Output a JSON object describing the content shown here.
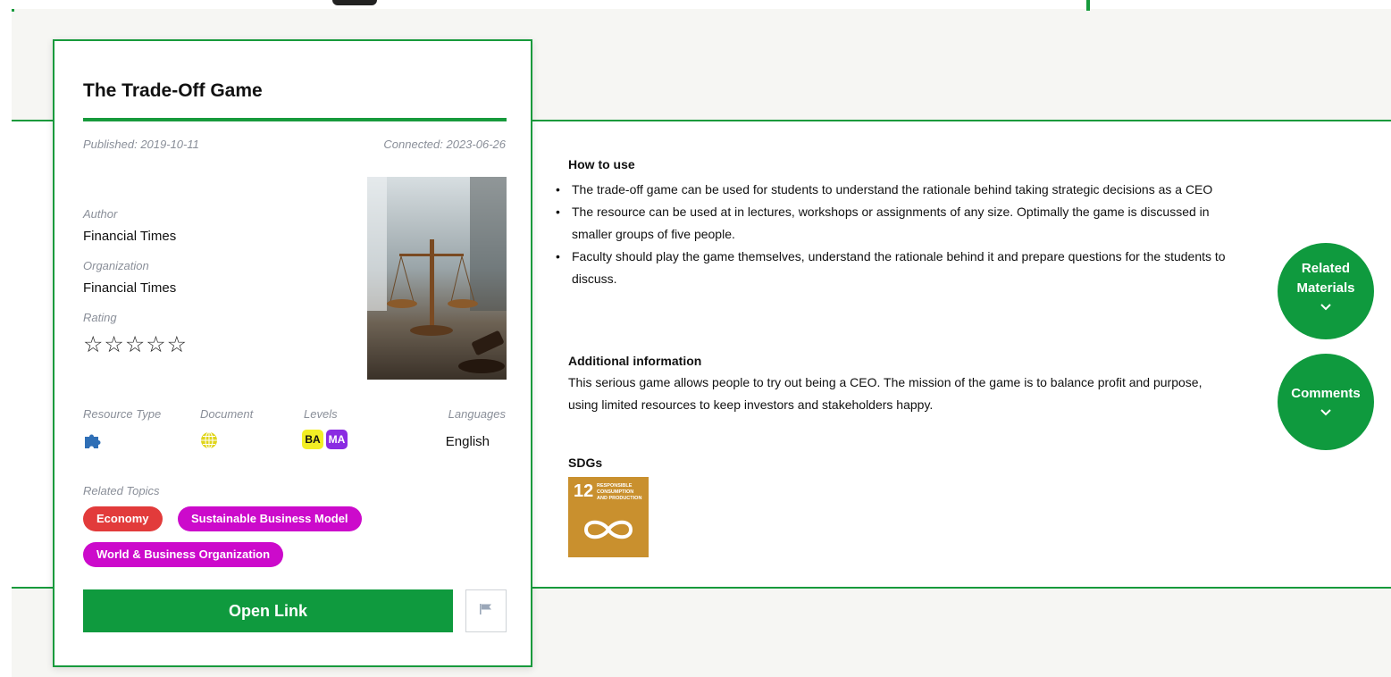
{
  "card": {
    "title": "The Trade-Off Game",
    "published": "Published: 2019-10-11",
    "connected": "Connected: 2023-06-26",
    "author_label": "Author",
    "author": "Financial Times",
    "organization_label": "Organization",
    "organization": "Financial Times",
    "rating_label": "Rating",
    "rating_stars": "☆☆☆☆☆",
    "rating_value": 0,
    "resource_type_label": "Resource Type",
    "resource_type_icon": "puzzle-icon",
    "document_label": "Document",
    "document_icon": "globe-icon",
    "levels_label": "Levels",
    "levels": [
      "BA",
      "MA"
    ],
    "languages_label": "Languages",
    "language": "English",
    "related_topics_label": "Related Topics",
    "topics": [
      {
        "label": "Economy",
        "color": "#e23b3b"
      },
      {
        "label": "Sustainable Business Model",
        "color": "#cc0acb"
      },
      {
        "label": "World & Business Organization",
        "color": "#cc0acb"
      }
    ],
    "open_label": "Open Link",
    "flag_icon": "flag-icon"
  },
  "content": {
    "how_to_use_heading": "How to use",
    "bullets": [
      "The trade-off game can be used for students to understand the rationale behind taking strategic decisions as a CEO",
      "The resource can be used at in lectures, workshops or assignments of any size. Optimally the game is discussed in smaller groups of five people.",
      "Faculty should play the game themselves, understand the rationale behind it and prepare questions for the students to discuss."
    ],
    "additional_heading": "Additional information",
    "additional_text": "This serious game allows people to try out being a CEO. The mission of the game is to balance profit and purpose, using limited resources to keep investors and stakeholders happy.",
    "sdgs_heading": "SDGs",
    "sdg_number": "12",
    "sdg_title": "RESPONSIBLE CONSUMPTION AND PRODUCTION",
    "sdg_color": "#c9902e"
  },
  "side": {
    "related_line1": "Related",
    "related_line2": "Materials",
    "comments_label": "Comments"
  },
  "colors": {
    "accent": "#179a3c",
    "button": "#0f9a3e"
  }
}
